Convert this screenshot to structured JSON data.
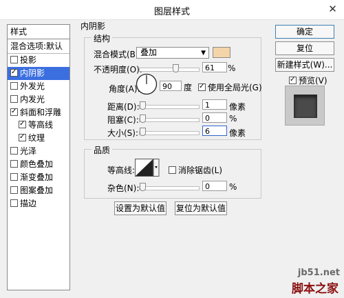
{
  "window": {
    "title": "图层样式",
    "close_glyph": "✕"
  },
  "styles_panel": {
    "title": "样式",
    "blend_options": "混合选项:默认",
    "items": [
      {
        "label": "投影",
        "checked": false,
        "sub": false,
        "selected": false
      },
      {
        "label": "内阴影",
        "checked": true,
        "sub": false,
        "selected": true
      },
      {
        "label": "外发光",
        "checked": false,
        "sub": false,
        "selected": false
      },
      {
        "label": "内发光",
        "checked": false,
        "sub": false,
        "selected": false
      },
      {
        "label": "斜面和浮雕",
        "checked": true,
        "sub": false,
        "selected": false
      },
      {
        "label": "等高线",
        "checked": true,
        "sub": true,
        "selected": false
      },
      {
        "label": "纹理",
        "checked": true,
        "sub": true,
        "selected": false
      },
      {
        "label": "光泽",
        "checked": false,
        "sub": false,
        "selected": false
      },
      {
        "label": "颜色叠加",
        "checked": false,
        "sub": false,
        "selected": false
      },
      {
        "label": "渐变叠加",
        "checked": false,
        "sub": false,
        "selected": false
      },
      {
        "label": "图案叠加",
        "checked": false,
        "sub": false,
        "selected": false
      },
      {
        "label": "描边",
        "checked": false,
        "sub": false,
        "selected": false
      }
    ]
  },
  "inner_shadow": {
    "title": "内阴影",
    "structure": {
      "legend": "结构",
      "blend_mode_label": "混合模式(B):",
      "blend_mode_value": "叠加",
      "color_swatch": "#f4d4a8",
      "opacity_label": "不透明度(O):",
      "opacity_value": "61",
      "opacity_unit": "%",
      "opacity_fraction": 0.61,
      "angle_label": "角度(A):",
      "angle_value": "90",
      "angle_unit": "度",
      "global_light_label": "使用全局光(G)",
      "global_light_checked": true,
      "distance_label": "距离(D):",
      "distance_value": "1",
      "distance_unit": "像素",
      "choke_label": "阻塞(C):",
      "choke_value": "0",
      "choke_unit": "%",
      "size_label": "大小(S):",
      "size_value": "6",
      "size_unit": "像素"
    },
    "quality": {
      "legend": "品质",
      "contour_label": "等高线:",
      "anti_alias_label": "消除锯齿(L)",
      "anti_alias_checked": false,
      "noise_label": "杂色(N):",
      "noise_value": "0",
      "noise_unit": "%"
    },
    "set_default": "设置为默认值",
    "reset_default": "复位为默认值"
  },
  "actions": {
    "ok": "确定",
    "reset": "复位",
    "new_style": "新建样式(W)...",
    "preview_label": "预览(V)",
    "preview_checked": true
  },
  "watermark": {
    "url": "jb51.net",
    "logo": "脚本之家"
  }
}
